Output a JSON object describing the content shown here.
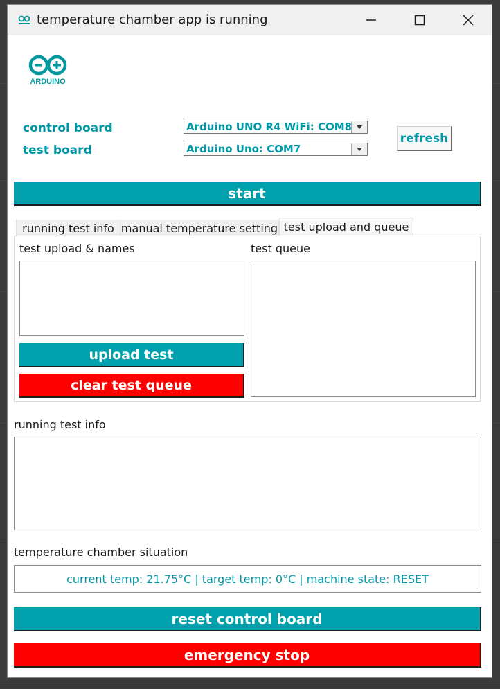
{
  "window": {
    "title": "temperature chamber app is running",
    "app_icon": "arduino-icon",
    "controls": [
      "minimize-icon",
      "maximize-icon",
      "close-icon"
    ]
  },
  "logo": {
    "text": "ARDUINO",
    "color": "#00979d"
  },
  "boards": {
    "control_label": "control board",
    "control_value": "Arduino UNO R4 WiFi: COM8",
    "test_label": "test board",
    "test_value": "Arduino Uno: COM7",
    "refresh_label": "refresh"
  },
  "start_label": "start",
  "tabs": [
    {
      "label": "running test info",
      "active": false
    },
    {
      "label": "manual temperature setting",
      "active": false
    },
    {
      "label": "test upload and queue",
      "active": true
    }
  ],
  "upload_panel": {
    "upload_names_label": "test upload & names",
    "test_queue_label": "test queue",
    "upload_button": "upload test",
    "clear_button": "clear test queue"
  },
  "running_info_label": "running test info",
  "situation": {
    "label": "temperature chamber situation",
    "status": "current temp: 21.75°C | target temp: 0°C | machine state: RESET"
  },
  "reset_button": "reset control board",
  "emergency_button": "emergency stop",
  "colors": {
    "teal": "#00a0ad",
    "text_teal": "#0097a7",
    "red": "#ff0000"
  }
}
